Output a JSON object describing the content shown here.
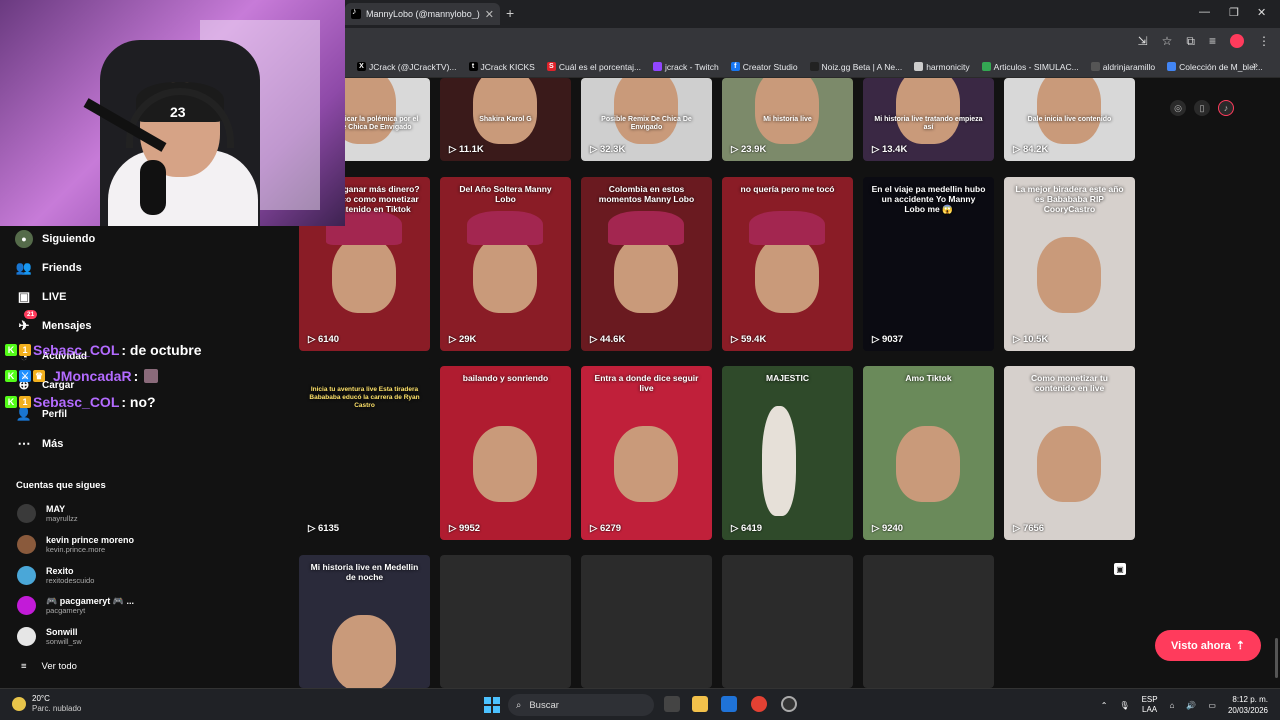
{
  "browser": {
    "tab_title": "MannyLobo (@mannylobo_) | T",
    "new_tab": "+",
    "bookmarks": [
      {
        "label": "JCrack (@JCrackTV)...",
        "color": "#000000",
        "glyph": "X"
      },
      {
        "label": "JCrack KICKS",
        "color": "#000000",
        "glyph": "t"
      },
      {
        "label": "Cuál es el porcentaj...",
        "color": "#e0222a",
        "glyph": "S"
      },
      {
        "label": "jcrack - Twitch",
        "color": "#9146ff",
        "glyph": ""
      },
      {
        "label": "Creator Studio",
        "color": "#1877f2",
        "glyph": "f"
      },
      {
        "label": "Noiz.gg Beta | A Ne...",
        "color": "#222222",
        "glyph": ""
      },
      {
        "label": "harmonicity",
        "color": "#cccccc",
        "glyph": ""
      },
      {
        "label": "Articulos - SIMULAC...",
        "color": "#34a853",
        "glyph": ""
      },
      {
        "label": "aldrinjaramillo",
        "color": "#555555",
        "glyph": ""
      },
      {
        "label": "Colección de M_blei...",
        "color": "#4285f4",
        "glyph": ""
      }
    ],
    "bookmarks_more": "»"
  },
  "sidebar": {
    "items": [
      {
        "label": "Siguiendo",
        "icon": "following-avatar-icon"
      },
      {
        "label": "Friends",
        "icon": "friends-icon"
      },
      {
        "label": "LIVE",
        "icon": "live-icon"
      },
      {
        "label": "Mensajes",
        "icon": "messages-icon",
        "badge": "21"
      },
      {
        "label": "Actividad",
        "icon": "activity-icon"
      },
      {
        "label": "Cargar",
        "icon": "upload-icon"
      },
      {
        "label": "Perfil",
        "icon": "profile-icon"
      },
      {
        "label": "Más",
        "icon": "more-icon"
      }
    ],
    "following_title": "Cuentas que sigues",
    "following": [
      {
        "name": "MAY",
        "handle": "mayrullzz",
        "color": "#3a3a3a"
      },
      {
        "name": "kevin prince moreno",
        "handle": "kevin.prince.more",
        "color": "#8a5a3c"
      },
      {
        "name": "Rexito",
        "handle": "rexitodescuido",
        "color": "#4aa7d8"
      },
      {
        "name": "🎮 pacgameryt 🎮 ...",
        "handle": "pacgameryt",
        "color": "#c21bd8"
      },
      {
        "name": "Sonwill",
        "handle": "sonwill_sw",
        "color": "#e6e6e6"
      }
    ],
    "see_all": "Ver todo"
  },
  "chat": [
    {
      "user": "Sebasc_COL",
      "message": ": de octubre"
    },
    {
      "user": "JMoncadaR",
      "message": ":"
    },
    {
      "user": "Sebasc_COL",
      "message": ": no?"
    }
  ],
  "webcam": {
    "cap_number": "23"
  },
  "videos": [
    {
      "views": "",
      "bg": "#d9d9d9",
      "caption": "Voy a explicar la polémica por el remix de Chica De Envigado",
      "kind": "white"
    },
    {
      "views": "11.1K",
      "bg": "#3a1a1a",
      "caption": "Shakira   Karol G",
      "kind": "red"
    },
    {
      "views": "32.3K",
      "bg": "#cfcfcf",
      "caption": "Posible Remix De Chica De Envigado",
      "kind": "white"
    },
    {
      "views": "23.9K",
      "bg": "#7c8a6a",
      "caption": "Mi historia live",
      "kind": "green"
    },
    {
      "views": "13.4K",
      "bg": "#3a2844",
      "caption": "Mi historia live tratando empieza así",
      "kind": "purple"
    },
    {
      "views": "84.2K",
      "bg": "#d8d8d8",
      "caption": "Dale inicia live contenido",
      "kind": "white"
    },
    {
      "views": "6140",
      "bg": "#8a1c26",
      "caption": "Quieres ganar más dinero? Te explico como monetizar mi contenido en Tiktok",
      "kind": "hat"
    },
    {
      "views": "29K",
      "bg": "#8a1c26",
      "caption": "Del Año Soltera Manny Lobo",
      "kind": "hat"
    },
    {
      "views": "44.6K",
      "bg": "#6a1a20",
      "caption": "Colombia en estos momentos Manny Lobo",
      "kind": "hat"
    },
    {
      "views": "59.4K",
      "bg": "#8a1c26",
      "caption": "no quería pero me tocó",
      "kind": "hat"
    },
    {
      "views": "9037",
      "bg": "#0b0b12",
      "caption": "En el viaje pa medellin hubo un accidente Yo Manny Lobo me 😱",
      "kind": "dark"
    },
    {
      "views": "10.5K",
      "bg": "#d6d0cc",
      "caption": "La mejor biradera este año es Babababa RIP CooryCastro",
      "kind": "face"
    },
    {
      "views": "6135",
      "bg": "#121212",
      "caption": "Inicia tu aventura live Esta tiradera Babababa educó la carrera de Ryan Castro",
      "kind": "clip"
    },
    {
      "views": "9952",
      "bg": "#b01c30",
      "caption": "bailando y sonriendo",
      "kind": "face"
    },
    {
      "views": "6279",
      "bg": "#c0203a",
      "caption": "Entra a donde dice seguir live",
      "kind": "face"
    },
    {
      "views": "6419",
      "bg": "#2f4a2a",
      "caption": "MAJESTIC",
      "kind": "majestic"
    },
    {
      "views": "9240",
      "bg": "#6a8a5a",
      "caption": "Amo Tiktok",
      "kind": "outdoor"
    },
    {
      "views": "7656",
      "bg": "#d6d0cc",
      "caption": "Como monetizar tu contenido en live",
      "kind": "face"
    },
    {
      "views": "",
      "bg": "#2a2a3a",
      "caption": "Mi historia live en Medellin de noche",
      "kind": "night"
    },
    {
      "views": "",
      "bg": "#2b2b2b",
      "caption": "",
      "kind": "empty"
    },
    {
      "views": "",
      "bg": "#2b2b2b",
      "caption": "",
      "kind": "empty"
    },
    {
      "views": "",
      "bg": "#2b2b2b",
      "caption": "",
      "kind": "empty"
    },
    {
      "views": "",
      "bg": "#2b2b2b",
      "caption": "",
      "kind": "empty"
    }
  ],
  "visto_ahora": "Visto ahora",
  "taskbar": {
    "temp": "20°C",
    "weather": "Parc. nublado",
    "search": "Buscar",
    "lang1": "ESP",
    "lang2": "LAA",
    "time": "8:12 p. m.",
    "date": "20/03/2026"
  }
}
